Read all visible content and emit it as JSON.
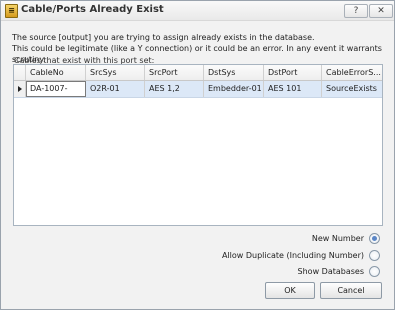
{
  "window": {
    "title": "Cable/Ports Already Exist",
    "app_icon_glyph": "≡",
    "help_button": "?",
    "close_button": "✕"
  },
  "message": {
    "line1": "The source [output] you are trying to assign already exists in the database.",
    "line2": "This could be legitimate (like a Y connection) or it could be an error. In any event it warrants scrutiny."
  },
  "grid": {
    "label": "Cables that exist with this port set:",
    "columns": [
      "CableNo",
      "SrcSys",
      "SrcPort",
      "DstSys",
      "DstPort",
      "CableErrorS..."
    ],
    "rows": [
      [
        "DA-1007-",
        "O2R-01",
        "AES 1,2",
        "Embedder-01",
        "AES 101",
        "SourceExists"
      ]
    ]
  },
  "options": [
    {
      "label": "New Number",
      "checked": true
    },
    {
      "label": "Allow Duplicate (Including Number)",
      "checked": false
    },
    {
      "label": "Show Databases",
      "checked": false
    }
  ],
  "buttons": {
    "ok": "OK",
    "cancel": "Cancel"
  },
  "colors": {
    "selected_row": "#dce8f7",
    "radio_checked": "#5b86c6"
  }
}
